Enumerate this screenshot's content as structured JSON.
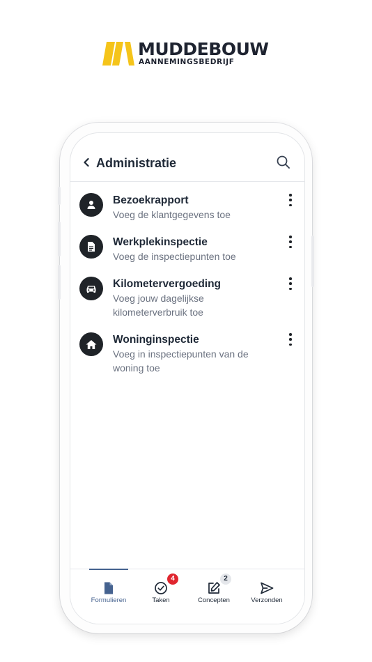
{
  "brand": {
    "name": "MUDDEBOUW",
    "subtitle": "AANNEMINGSBEDRIJF",
    "accent_color": "#F5C41A",
    "logo_icon": "muddebouw-logo-icon"
  },
  "header": {
    "title": "Administratie",
    "back_icon": "chevron-left-icon",
    "search_icon": "search-icon"
  },
  "forms": [
    {
      "title": "Bezoekrapport",
      "subtitle": "Voeg de klantgegevens toe",
      "icon": "person-icon"
    },
    {
      "title": "Werkplekinspectie",
      "subtitle": "Voeg de inspectiepunten toe",
      "icon": "document-icon"
    },
    {
      "title": "Kilometervergoeding",
      "subtitle": "Voeg jouw dagelijkse kilometerverbruik toe",
      "icon": "car-icon"
    },
    {
      "title": "Woninginspectie",
      "subtitle": "Voeg in inspectiepunten van de woning toe",
      "icon": "house-icon"
    }
  ],
  "nav": {
    "active": "Formulieren",
    "active_color": "#45628F",
    "items": [
      {
        "label": "Formulieren",
        "icon": "file-icon",
        "badge": ""
      },
      {
        "label": "Taken",
        "icon": "check-circle-icon",
        "badge": "4",
        "badge_color": "#E0262F"
      },
      {
        "label": "Concepten",
        "icon": "edit-icon",
        "badge": "2"
      },
      {
        "label": "Verzonden",
        "icon": "send-icon",
        "badge": ""
      }
    ]
  }
}
